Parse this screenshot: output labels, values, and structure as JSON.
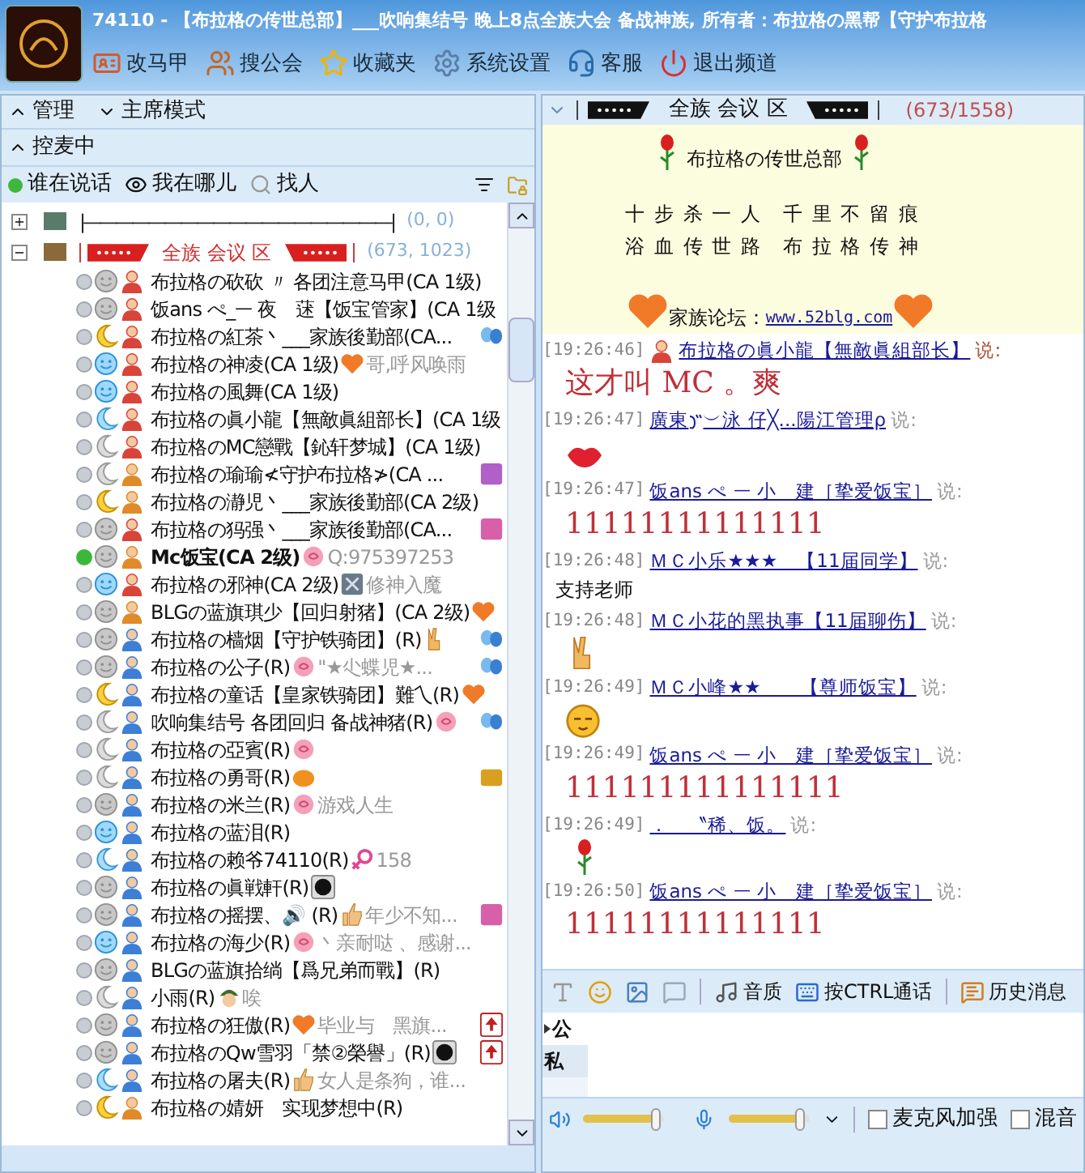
{
  "window": {
    "title": "74110 - 【布拉格の传世总部】___吹响集结号 晚上8点全族大会 备战神族, 所有者：布拉格の黑帮【守护布拉格"
  },
  "toolbar": [
    {
      "kind": "card",
      "label": "改马甲"
    },
    {
      "kind": "group",
      "label": "搜公会"
    },
    {
      "kind": "star",
      "label": "收藏夹"
    },
    {
      "kind": "settings",
      "label": "系统设置"
    },
    {
      "kind": "service",
      "label": "客服"
    },
    {
      "kind": "power",
      "label": "退出频道"
    }
  ],
  "left": {
    "sections": [
      {
        "label": "管理",
        "expanded": true
      },
      {
        "label": "主席模式",
        "expanded": false
      },
      {
        "label": "控麦中",
        "expanded": true
      }
    ],
    "tools": [
      {
        "kind": "dot",
        "label": "谁在说话"
      },
      {
        "kind": "eye",
        "label": "我在哪儿"
      },
      {
        "kind": "search",
        "label": "找人"
      }
    ],
    "groups": [
      {
        "expanded": false,
        "label": "|———————————————————|",
        "count": "(0, 0)"
      },
      {
        "expanded": true,
        "label": "全族 会议 区",
        "count": "(673, 1023)"
      }
    ],
    "members": [
      {
        "name": "布拉格の砍砍 〃 各团注意马甲(CA 1级)",
        "speaking": false,
        "face": {
          "kind": "gray"
        },
        "color": "#d9443a"
      },
      {
        "name": "饭ans ぺ_ᅳ 夜　蒁【饭宝管家】(CA 1级",
        "speaking": false,
        "face": {
          "kind": "gray"
        },
        "color": "#d9443a"
      },
      {
        "name": "布拉格の紅茶丶___家族後勤部(CA...",
        "speaking": false,
        "face": {
          "kind": "moon-yellow"
        },
        "color": "#d9443a",
        "tag": {
          "kind": "butterfly"
        }
      },
      {
        "name": "布拉格の神凌(CA 1级)",
        "speaking": false,
        "face": {
          "kind": "blue"
        },
        "color": "#d9443a",
        "emblem": {
          "kind": "heart"
        },
        "signature": "哥,呼风唤雨"
      },
      {
        "name": "布拉格の風舞(CA 1级)",
        "speaking": false,
        "face": {
          "kind": "blue"
        },
        "color": "#d9443a"
      },
      {
        "name": "布拉格の眞小龍【無敵眞組部长】(CA 1级",
        "speaking": false,
        "face": {
          "kind": "moon-blue"
        },
        "color": "#d9443a"
      },
      {
        "name": "布拉格のMC戀戰【鈊轩梦城】(CA 1级)",
        "speaking": false,
        "face": {
          "kind": "moon-gray"
        },
        "color": "#d9443a"
      },
      {
        "name": "布拉格の瑜瑜≮守护布拉格≯(CA ...",
        "speaking": false,
        "face": {
          "kind": "moon-gray"
        },
        "color": "#e08a2a",
        "tag": {
          "kind": "purple"
        }
      },
      {
        "name": "布拉格の瀞児丶___家族後勤部(CA 2级)",
        "speaking": false,
        "face": {
          "kind": "moon-yellow"
        },
        "color": "#e08a2a"
      },
      {
        "name": "布拉格の犸强丶___家族後勤部(CA...",
        "speaking": false,
        "face": {
          "kind": "gray"
        },
        "color": "#d9443a",
        "tag": {
          "kind": "pink"
        }
      },
      {
        "name": "Mc饭宝(CA 2级)",
        "speaking": true,
        "face": {
          "kind": "gray"
        },
        "color": "#e08a2a",
        "emblem": {
          "kind": "rose"
        },
        "signature": "Q:975397253"
      },
      {
        "name": "布拉格の邪神(CA 2级)",
        "speaking": false,
        "face": {
          "kind": "blue"
        },
        "color": "#d9443a",
        "emblem": {
          "kind": "badge"
        },
        "signature": "修神入魔"
      },
      {
        "name": "BLGの蓝旗琪少【回归射猪】(CA 2级)",
        "speaking": false,
        "face": {
          "kind": "gray"
        },
        "color": "#e08a2a",
        "emblem": {
          "kind": "heart"
        }
      },
      {
        "name": "布拉格の樯烟【守护铁骑团】(R)",
        "speaking": false,
        "face": {
          "kind": "gray"
        },
        "color": "#3d7fd6",
        "emblem": {
          "kind": "peace"
        },
        "tag": {
          "kind": "butterfly"
        }
      },
      {
        "name": "布拉格の公子(R)",
        "speaking": false,
        "face": {
          "kind": "gray"
        },
        "color": "#3d7fd6",
        "emblem": {
          "kind": "rose"
        },
        "signature": "\"★尐蝶児★...",
        "tag": {
          "kind": "butterfly"
        }
      },
      {
        "name": "布拉格の童话【皇家铁骑团】難乀(R)",
        "speaking": false,
        "face": {
          "kind": "moon-yellow"
        },
        "color": "#3d7fd6",
        "emblem": {
          "kind": "heart"
        }
      },
      {
        "name": "吹响集结号 各团回归 备战神猪(R)",
        "speaking": false,
        "face": {
          "kind": "moon-gray"
        },
        "color": "#3d7fd6",
        "emblem": {
          "kind": "rose"
        },
        "tag": {
          "kind": "butterfly"
        }
      },
      {
        "name": "布拉格の亞賓(R)",
        "speaking": false,
        "face": {
          "kind": "moon-gray"
        },
        "color": "#3d7fd6",
        "emblem": {
          "kind": "rose"
        }
      },
      {
        "name": "布拉格の勇哥(R)",
        "speaking": false,
        "face": {
          "kind": "moon-gray"
        },
        "color": "#3d7fd6",
        "emblem": {
          "kind": "pumpkin"
        },
        "tag": {
          "kind": "gold"
        }
      },
      {
        "name": "布拉格の米兰(R)",
        "speaking": false,
        "face": {
          "kind": "gray"
        },
        "color": "#3d7fd6",
        "emblem": {
          "kind": "rose"
        },
        "signature": "游戏人生"
      },
      {
        "name": "布拉格の蓝泪(R)",
        "speaking": false,
        "face": {
          "kind": "blue"
        },
        "color": "#3d7fd6"
      },
      {
        "name": "布拉格の赖爷74110(R)",
        "speaking": false,
        "face": {
          "kind": "moon-blue"
        },
        "color": "#3d7fd6",
        "emblem": {
          "kind": "female"
        },
        "signature": "158"
      },
      {
        "name": "布拉格の眞戦軒(R)",
        "speaking": false,
        "face": {
          "kind": "gray"
        },
        "color": "#3d7fd6",
        "emblem": {
          "kind": "disc"
        }
      },
      {
        "name": "布拉格の摇摆、🔊 (R)",
        "speaking": false,
        "face": {
          "kind": "gray"
        },
        "color": "#3d7fd6",
        "emblem": {
          "kind": "thumb"
        },
        "signature": "年少不知...",
        "tag": {
          "kind": "pink"
        }
      },
      {
        "name": "布拉格の海少(R)",
        "speaking": false,
        "face": {
          "kind": "blue"
        },
        "color": "#3d7fd6",
        "emblem": {
          "kind": "rose"
        },
        "signature": "丶亲耐哒 、感谢..."
      },
      {
        "name": "BLGの蓝旗拾绱【爲兄弟而戰】(R)",
        "speaking": false,
        "face": {
          "kind": "gray"
        },
        "color": "#3d7fd6"
      },
      {
        "name": "小雨(R)",
        "speaking": false,
        "face": {
          "kind": "moon-gray"
        },
        "color": "#3d7fd6",
        "emblem": {
          "kind": "soldier"
        },
        "signature": "唉"
      },
      {
        "name": "布拉格の狂傲(R)",
        "speaking": false,
        "face": {
          "kind": "gray"
        },
        "color": "#3d7fd6",
        "emblem": {
          "kind": "heart"
        },
        "signature": "毕业与　黑旗...",
        "tag": {
          "kind": "card"
        }
      },
      {
        "name": "布拉格のQw雪羽「禁②榮譽」(R)",
        "speaking": false,
        "face": {
          "kind": "gray"
        },
        "color": "#3d7fd6",
        "emblem": {
          "kind": "disc"
        },
        "tag": {
          "kind": "card"
        }
      },
      {
        "name": "布拉格の屠夫(R)",
        "speaking": false,
        "face": {
          "kind": "moon-blue"
        },
        "color": "#3d7fd6",
        "emblem": {
          "kind": "thumb"
        },
        "signature": "女人是条狗，谁..."
      },
      {
        "name": "布拉格の婧妍　实现梦想中(R)",
        "speaking": false,
        "face": {
          "kind": "moon-yellow"
        },
        "color": "#e08a2a"
      }
    ]
  },
  "room": {
    "label": "全族 会议 区",
    "count": "(673/1558)"
  },
  "notice": {
    "title": "布拉格の传世总部",
    "lines": [
      "十 步 杀 一 人　千 里 不 留 痕",
      "浴 血 传 世 路　布 拉 格 传 神"
    ],
    "forum_label": "家族论坛：",
    "forum_link": "www.52blg.com"
  },
  "messages": [
    {
      "time": "[19:26:46]",
      "sender": "布拉格の眞小龍【無敵眞組部长】",
      "said": "说:",
      "avatar": true,
      "content": {
        "kind": "red",
        "text": "这才叫 MC 。爽"
      }
    },
    {
      "time": "[19:26:47]",
      "sender": "廣東",
      "sender_icon": {
        "kind": "squiggle"
      },
      "sender_rest": "︶泳 仔╳...陽江管理ρ",
      "said": "说:",
      "avatar": false,
      "content": {
        "kind": "lips"
      }
    },
    {
      "time": "[19:26:47]",
      "sender": "饭ans ぺ ᅳ 小　建［挚爱饭宝］",
      "said": "说:",
      "avatar": false,
      "content": {
        "kind": "red",
        "text": "11111111111111"
      }
    },
    {
      "time": "[19:26:48]",
      "sender": "ＭＣ小乐★★★　【11届同学】",
      "said": "说:",
      "avatar": false,
      "content": {
        "kind": "plain",
        "text": "支持老师"
      }
    },
    {
      "time": "[19:26:48]",
      "sender": "ＭＣ小花的黑执事【11届聊伤】",
      "said": "说:",
      "avatar": false,
      "content": {
        "kind": "peace"
      }
    },
    {
      "time": "[19:26:49]",
      "sender": "ＭＣ小峰★★　　【尊师饭宝】",
      "said": "说:",
      "avatar": false,
      "content": {
        "kind": "shy"
      }
    },
    {
      "time": "[19:26:49]",
      "sender": "饭ans ぺ ᅳ 小　建［挚爱饭宝］",
      "said": "说:",
      "avatar": false,
      "content": {
        "kind": "red",
        "text": "111111111111111"
      }
    },
    {
      "time": "[19:26:49]",
      "sender": "．　〝稀、饭。",
      "said": "说:",
      "avatar": false,
      "content": {
        "kind": "rose"
      }
    },
    {
      "time": "[19:26:50]",
      "sender": "饭ans ぺ ᅳ 小　建［挚爱饭宝］",
      "said": "说:",
      "avatar": false,
      "content": {
        "kind": "red",
        "text": "11111111111111"
      }
    }
  ],
  "chat_tools": [
    {
      "kind": "font"
    },
    {
      "kind": "smiley"
    },
    {
      "kind": "picture"
    },
    {
      "kind": "bubble"
    },
    {
      "kind": "music",
      "label": "音质"
    },
    {
      "kind": "key",
      "label": "按CTRL通话"
    },
    {
      "kind": "history",
      "label": "历史消息"
    }
  ],
  "input_tabs": [
    {
      "label": "公",
      "selected": true
    },
    {
      "label": "私",
      "selected": false
    }
  ],
  "audio": {
    "speaker": {
      "level": 0.95
    },
    "mic": {
      "level": 0.95
    },
    "options": [
      {
        "label": "麦克风加强",
        "checked": false
      },
      {
        "label": "混音",
        "checked": false
      }
    ]
  }
}
